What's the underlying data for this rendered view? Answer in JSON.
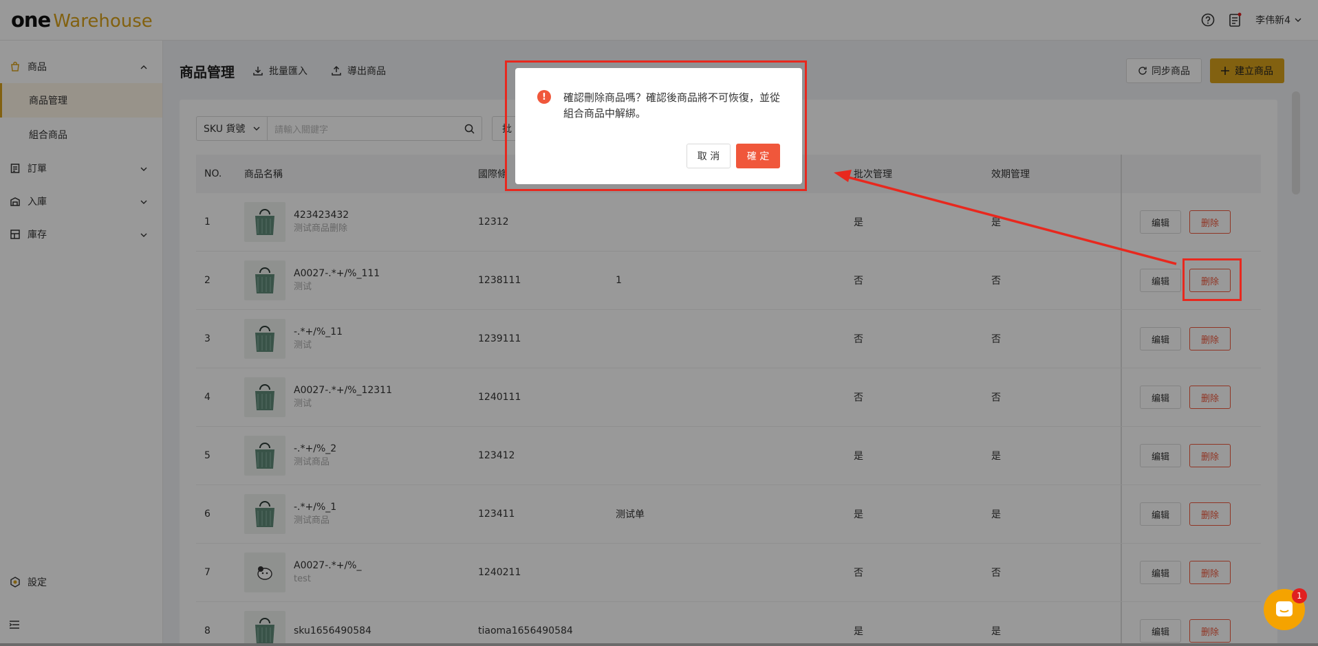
{
  "brand": {
    "one": "one",
    "name": "Warehouse"
  },
  "header": {
    "user": "李伟新4"
  },
  "sidebar": {
    "groups": [
      {
        "label": "商品",
        "icon": "product-icon"
      },
      {
        "label": "訂單",
        "icon": "order-icon"
      },
      {
        "label": "入庫",
        "icon": "inbound-icon"
      },
      {
        "label": "庫存",
        "icon": "inventory-icon"
      }
    ],
    "subs": [
      "商品管理",
      "組合商品"
    ],
    "settings": "設定"
  },
  "toolbar": {
    "title": "商品管理",
    "import": "批量匯入",
    "export": "導出商品",
    "sync": "同步商品",
    "create": "建立商品"
  },
  "filters": {
    "select": "SKU 貨號",
    "placeholder": "請輸入關鍵字",
    "batch": "批"
  },
  "table": {
    "headers": {
      "no": "NO.",
      "name": "商品名稱",
      "code": "國際條",
      "batch": "批次管理",
      "exp": "效期管理"
    },
    "rows": [
      {
        "no": "1",
        "name": "423423432",
        "sub": "测试商品删除",
        "code": "12312",
        "extra": "",
        "batch": "是",
        "exp": "是"
      },
      {
        "no": "2",
        "name": "A0027-.*+/%_111",
        "sub": "测试",
        "code": "1238111",
        "extra": "1",
        "batch": "否",
        "exp": "否"
      },
      {
        "no": "3",
        "name": "-.*+/%_11",
        "sub": "测试",
        "code": "1239111",
        "extra": "",
        "batch": "否",
        "exp": "否"
      },
      {
        "no": "4",
        "name": "A0027-.*+/%_12311",
        "sub": "测试",
        "code": "1240111",
        "extra": "",
        "batch": "否",
        "exp": "否"
      },
      {
        "no": "5",
        "name": "-.*+/%_2",
        "sub": "测试商品",
        "code": "123412",
        "extra": "",
        "batch": "是",
        "exp": "是"
      },
      {
        "no": "6",
        "name": "-.*+/%_1",
        "sub": "测试商品",
        "code": "123411",
        "extra": "测试单",
        "batch": "是",
        "exp": "是"
      },
      {
        "no": "7",
        "name": "A0027-.*+/%_",
        "sub": "test",
        "code": "1240211",
        "extra": "",
        "batch": "否",
        "exp": "否"
      },
      {
        "no": "8",
        "name": "sku1656490584",
        "sub": "",
        "code": "tiaoma1656490584",
        "extra": "",
        "batch": "是",
        "exp": "是"
      }
    ],
    "edit_label": "编辑",
    "delete_label": "删除"
  },
  "modal": {
    "message": "確認刪除商品嗎？確認後商品將不可恢復，並從組合商品中解綁。",
    "cancel": "取 消",
    "ok": "確 定"
  },
  "chat": {
    "badge": "1"
  },
  "colors": {
    "accent": "#d9a21b",
    "danger": "#f0573b",
    "highlight": "#e8281e"
  }
}
